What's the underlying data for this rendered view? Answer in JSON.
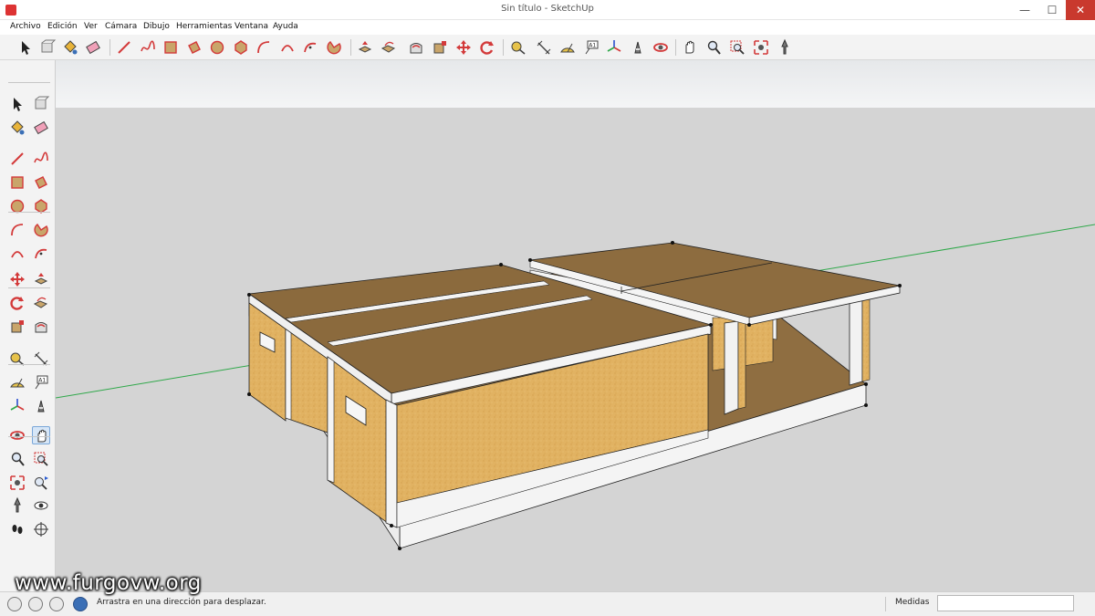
{
  "window": {
    "title": "Sin título - SketchUp",
    "minimize_glyph": "—",
    "maximize_glyph": "☐",
    "close_glyph": "✕"
  },
  "menu": [
    {
      "label": "Archivo"
    },
    {
      "label": "Edición"
    },
    {
      "label": "Ver"
    },
    {
      "label": "Cámara"
    },
    {
      "label": "Dibujo"
    },
    {
      "label": "Herramientas"
    },
    {
      "label": "Ventana"
    },
    {
      "label": "Ayuda"
    }
  ],
  "toolbar_icons": [
    "select-icon",
    "make-component-icon",
    "paint-bucket-icon",
    "eraser-icon",
    "line-icon",
    "freehand-icon",
    "rectangle-icon",
    "rotated-rectangle-icon",
    "circle-icon",
    "polygon-icon",
    "arc-icon",
    "two-point-arc-icon",
    "three-point-arc-icon",
    "pie-icon",
    "push-pull-icon",
    "follow-me-icon",
    "offset-icon",
    "scale-icon",
    "move-icon",
    "rotate-icon",
    "tape-measure-icon",
    "dimension-icon",
    "protractor-icon",
    "text-icon",
    "axes-icon",
    "3d-text-icon",
    "orbit-icon",
    "pan-icon",
    "zoom-icon",
    "zoom-window-icon",
    "zoom-extents-icon",
    "position-camera-icon"
  ],
  "sidebar_icons": [
    "select-icon",
    "make-component-icon",
    "paint-bucket-icon",
    "eraser-icon",
    "line-icon",
    "freehand-icon",
    "rectangle-icon",
    "rotated-rectangle-icon",
    "circle-icon",
    "polygon-icon",
    "arc-icon",
    "pie-icon",
    "two-point-arc-icon",
    "three-point-arc-icon",
    "move-icon",
    "push-pull-icon",
    "rotate-icon",
    "follow-me-icon",
    "scale-icon",
    "offset-icon",
    "tape-measure-icon",
    "dimension-icon",
    "protractor-icon",
    "text-icon",
    "axes-icon",
    "3d-text-icon",
    "orbit-icon",
    "pan-icon",
    "zoom-icon",
    "zoom-window-icon",
    "zoom-extents-icon",
    "previous-view-icon",
    "position-camera-icon",
    "look-around-icon",
    "walk-icon",
    "section-plane-icon"
  ],
  "sidebar_active": "pan-icon",
  "status": {
    "hint": "Arrastra en una dirección para desplazar.",
    "measure_label": "Medidas",
    "measure_value": "",
    "icons": [
      "geo-location-icon",
      "credits-icon",
      "user-icon",
      "help-icon"
    ]
  },
  "watermark": "www.furgovw.org",
  "colors": {
    "sky": "#eceef0",
    "ground": "#d4d4d4",
    "wood_side": "#e0b15e",
    "wood_top": "#8a6a3f",
    "edge_white": "#f4f4f4",
    "axis_green": "#2fa84a",
    "sketchup_red": "#d33a3a"
  }
}
